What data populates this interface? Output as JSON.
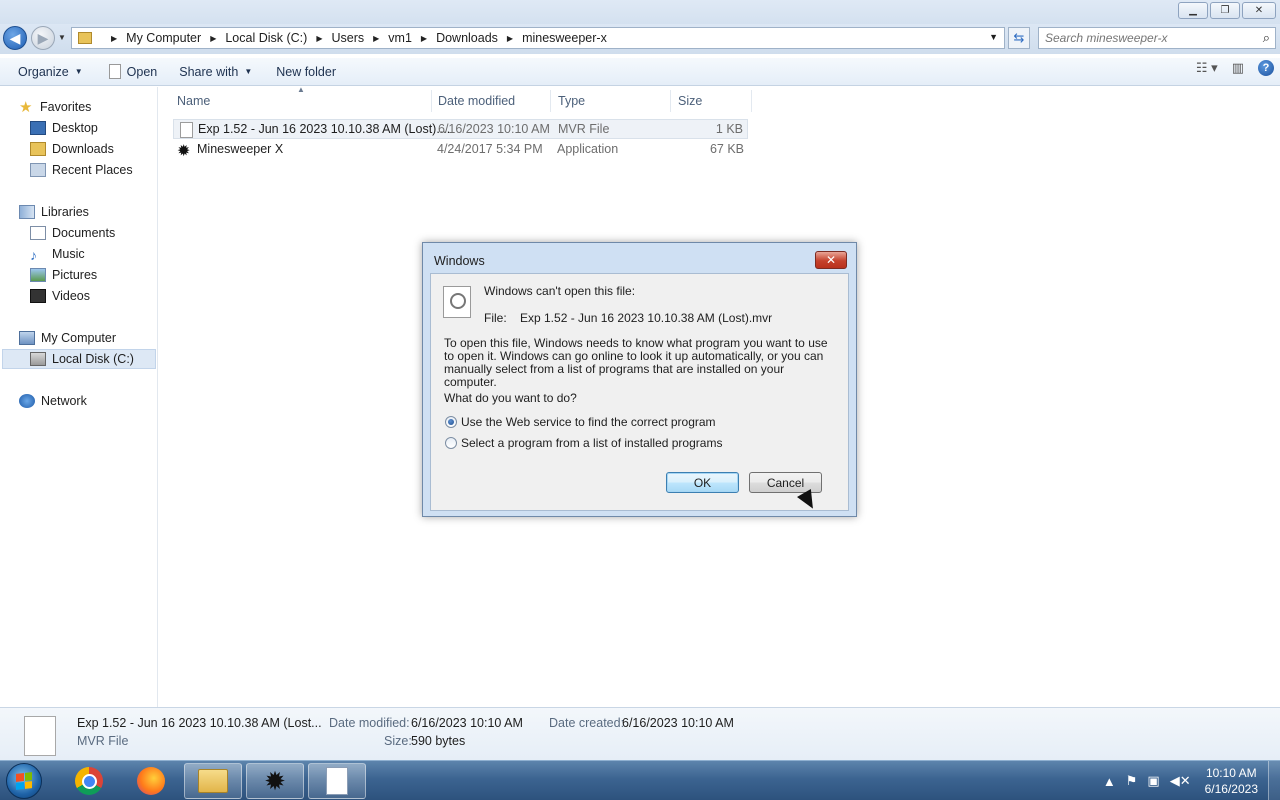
{
  "window": {
    "minimize_icon": "minimize-icon",
    "maximize_icon": "restore-icon",
    "close_icon": "close-icon"
  },
  "address": {
    "crumbs": [
      "My Computer",
      "Local Disk (C:)",
      "Users",
      "vm1",
      "Downloads",
      "minesweeper-x"
    ],
    "search_placeholder": "Search minesweeper-x"
  },
  "toolbar": {
    "organize": "Organize",
    "open": "Open",
    "share_with": "Share with",
    "new_folder": "New folder"
  },
  "sidebar": {
    "favorites": "Favorites",
    "desktop": "Desktop",
    "downloads": "Downloads",
    "recent_places": "Recent Places",
    "libraries": "Libraries",
    "documents": "Documents",
    "music": "Music",
    "pictures": "Pictures",
    "videos": "Videos",
    "my_computer": "My Computer",
    "local_disk": "Local Disk (C:)",
    "network": "Network"
  },
  "columns": {
    "name": "Name",
    "date_modified": "Date modified",
    "type": "Type",
    "size": "Size"
  },
  "files": [
    {
      "name": "Exp 1.52 - Jun 16 2023 10.10.38 AM (Lost)....",
      "date": "6/16/2023 10:10 AM",
      "type": "MVR File",
      "size": "1 KB"
    },
    {
      "name": "Minesweeper X",
      "date": "4/24/2017 5:34 PM",
      "type": "Application",
      "size": "67 KB"
    }
  ],
  "details": {
    "name": "Exp 1.52 - Jun 16 2023 10.10.38 AM (Lost...",
    "type": "MVR File",
    "date_modified_label": "Date modified:",
    "date_modified": "6/16/2023 10:10 AM",
    "date_created_label": "Date created:",
    "date_created": "6/16/2023 10:10 AM",
    "size_label": "Size:",
    "size": "590 bytes"
  },
  "dialog": {
    "title": "Windows",
    "heading": "Windows can't open this file:",
    "file_label": "File:",
    "file_name": "Exp 1.52 - Jun 16 2023 10.10.38 AM (Lost).mvr",
    "paragraph": "To open this file, Windows needs to know what program you want to use to open it. Windows can go online to look it up automatically, or you can manually select from a list of programs that are installed on your computer.",
    "question": "What do you want to do?",
    "option_web": "Use the Web service to find the correct program",
    "option_list": "Select a program from a list of installed programs",
    "selected_option": "web",
    "ok": "OK",
    "cancel": "Cancel"
  },
  "taskbar": {
    "time": "10:10 AM",
    "date": "6/16/2023"
  }
}
